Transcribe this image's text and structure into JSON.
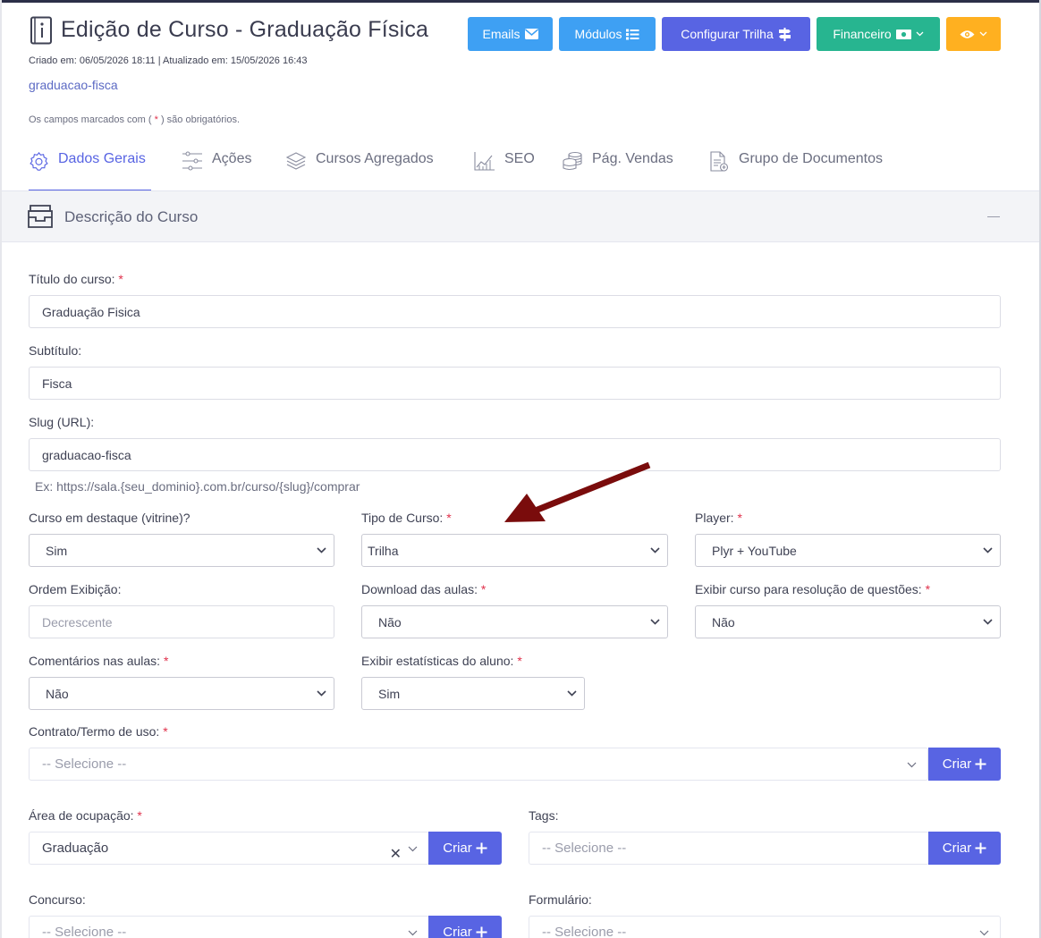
{
  "header": {
    "title": "Edição de Curso - Graduação Física",
    "meta": "Criado em: 06/05/2026 18:11 | Atualizado em: 15/05/2026 16:43",
    "slug_link": "graduacao-fisca",
    "required_note_prefix": "Os campos marcados com (",
    "required_note_star": "*",
    "required_note_suffix": ") são obrigatórios."
  },
  "toolbar": {
    "emails_label": "Emails",
    "modulos_label": "Módulos",
    "trilha_label": "Configurar Trilha",
    "financeiro_label": "Financeiro"
  },
  "tabs": [
    {
      "label": "Dados Gerais",
      "icon": "gear-icon",
      "active": true
    },
    {
      "label": "Ações",
      "icon": "sliders-icon",
      "active": false
    },
    {
      "label": "Cursos Agregados",
      "icon": "layers-icon",
      "active": false
    },
    {
      "label": "SEO",
      "icon": "chart-icon",
      "active": false
    },
    {
      "label": "Pág. Vendas",
      "icon": "coins-icon",
      "active": false
    },
    {
      "label": "Grupo de Documentos",
      "icon": "document-icon",
      "active": false
    }
  ],
  "section": {
    "title": "Descrição do Curso",
    "icon": "inbox-icon"
  },
  "form": {
    "titulo": {
      "label": "Título do curso:",
      "value": "Graduação Fisica"
    },
    "subtitulo": {
      "label": "Subtítulo:",
      "value": "Fisca"
    },
    "slug": {
      "label": "Slug (URL):",
      "value": "graduacao-fisca",
      "helper": "Ex: https://sala.{seu_dominio}.com.br/curso/{slug}/comprar"
    },
    "destaque": {
      "label": "Curso em destaque (vitrine)?",
      "value": "Sim"
    },
    "tipo": {
      "label": "Tipo de Curso:",
      "value": "Trilha"
    },
    "player": {
      "label": "Player:",
      "value": "Plyr + YouTube"
    },
    "ordem": {
      "label": "Ordem Exibição:",
      "placeholder": "Decrescente"
    },
    "download": {
      "label": "Download das aulas:",
      "value": "Não"
    },
    "resolucao": {
      "label": "Exibir curso para resolução de questões:",
      "value": "Não"
    },
    "comentarios": {
      "label": "Comentários nas aulas:",
      "value": "Não"
    },
    "estatisticas": {
      "label": "Exibir estatísticas do aluno:",
      "value": "Sim"
    },
    "contrato": {
      "label": "Contrato/Termo de uso:",
      "placeholder": "-- Selecione --"
    },
    "area": {
      "label": "Área de ocupação:",
      "value": "Graduação"
    },
    "tags": {
      "label": "Tags:",
      "placeholder": "-- Selecione --"
    },
    "concurso": {
      "label": "Concurso:",
      "placeholder": "-- Selecione --"
    },
    "formulario": {
      "label": "Formulário:",
      "placeholder": "-- Selecione --"
    },
    "required_star": "*",
    "criar_label": "Criar"
  },
  "colors": {
    "primary": "#5864e3",
    "info": "#3ea0f3",
    "success": "#27b590",
    "warning": "#ffb020",
    "danger": "#e0314b",
    "annotation_arrow": "#7a0c0c"
  }
}
